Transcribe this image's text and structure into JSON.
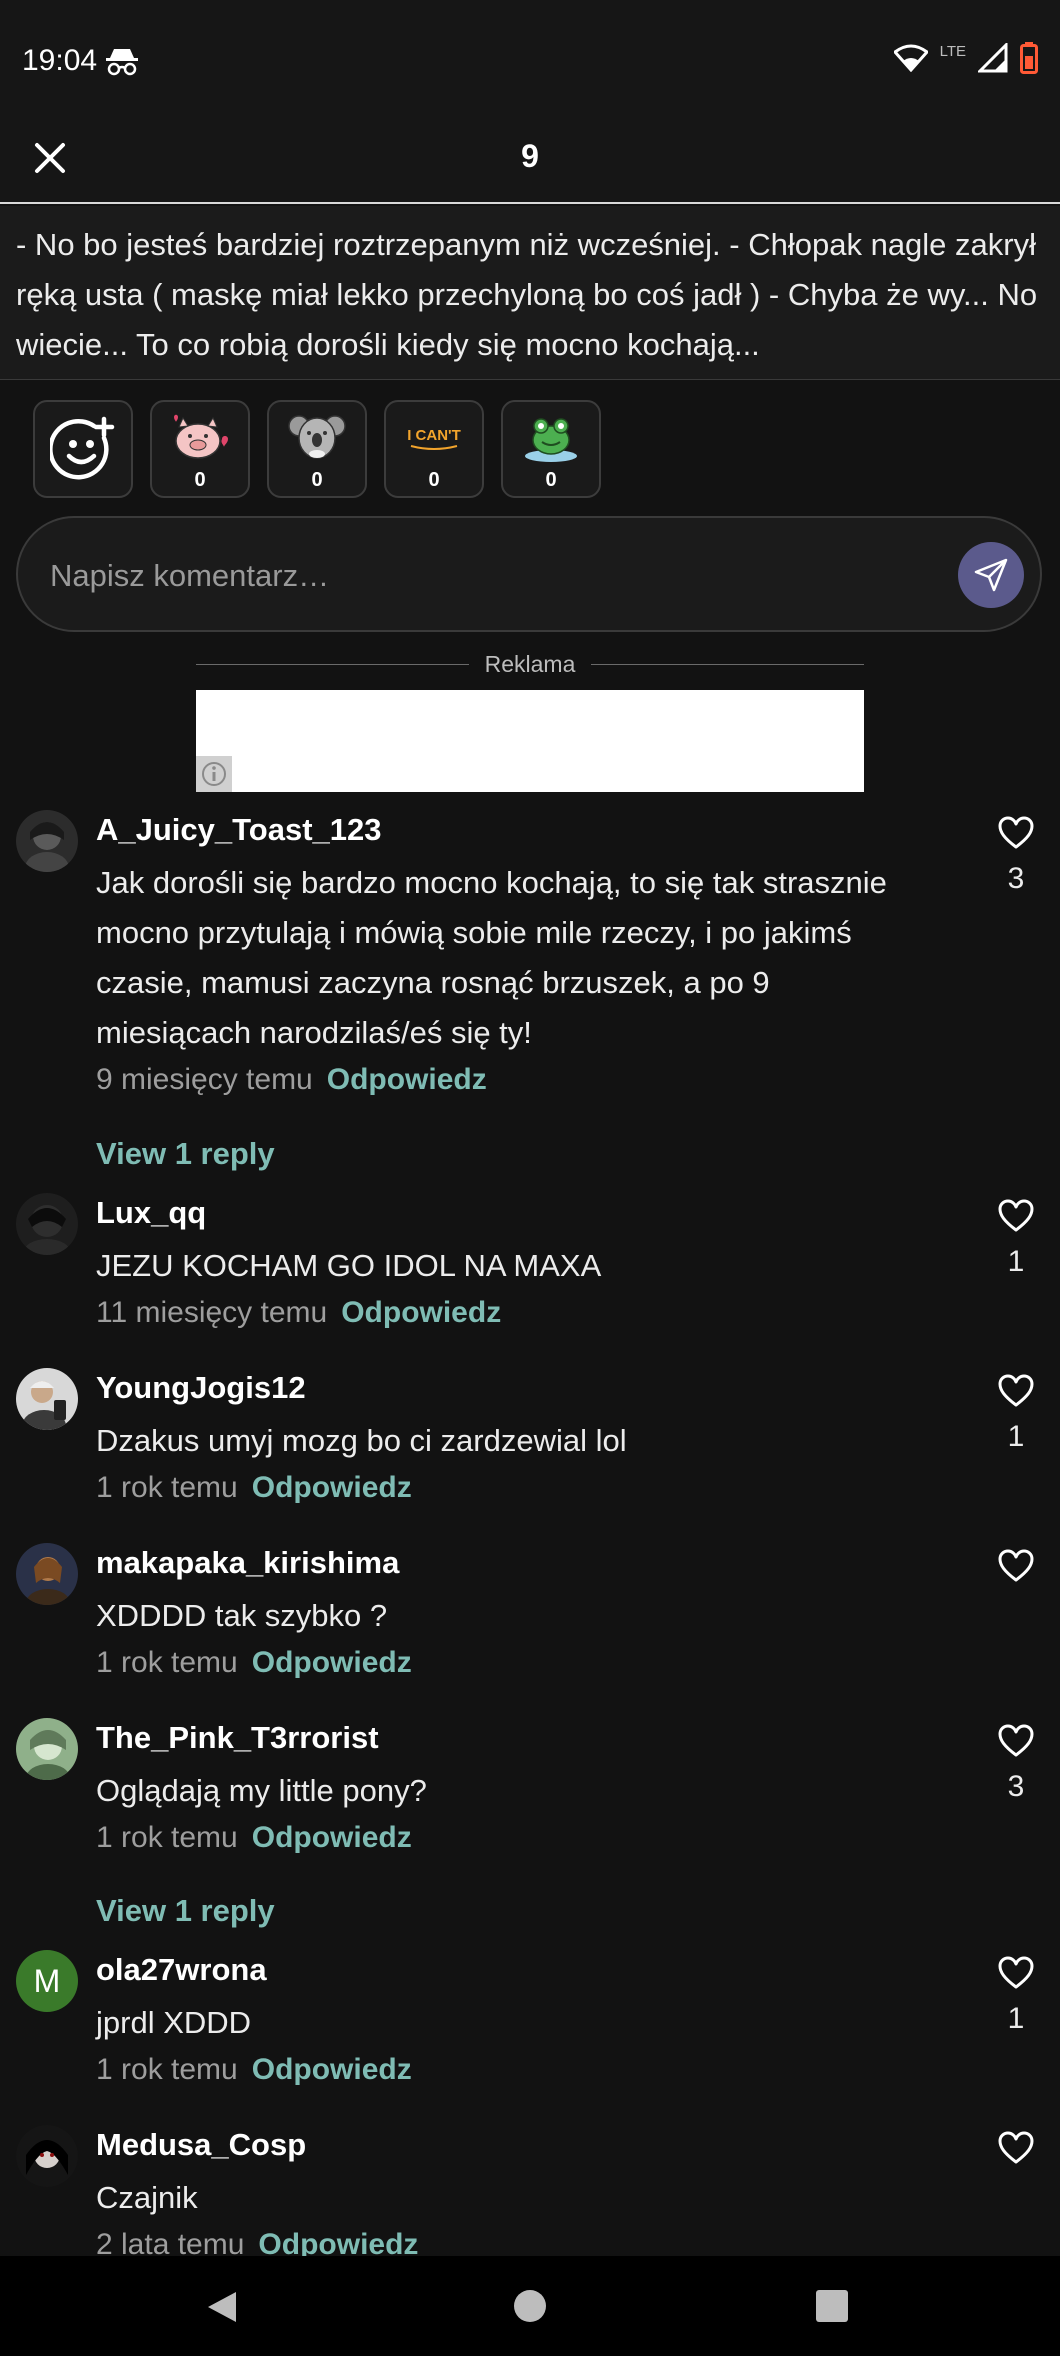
{
  "status_bar": {
    "time": "19:04",
    "network": "LTE"
  },
  "header": {
    "title": "9"
  },
  "story": {
    "text": "- No bo jesteś bardziej roztrzepanym niż wcześniej. - Chłopak nagle zakrył ręką usta ( maskę miał lekko przechyloną bo coś jadł ) - Chyba że wy... No wiecie... To co robią dorośli kiedy się mocno kochają..."
  },
  "reactions": [
    {
      "icon": "pig-sticker-icon",
      "count": "0"
    },
    {
      "icon": "koala-sticker-icon",
      "count": "0"
    },
    {
      "icon": "i-cant-sticker-icon",
      "sticker_text": "I CAN'T",
      "count": "0"
    },
    {
      "icon": "frog-sticker-icon",
      "count": "0"
    }
  ],
  "comment_input": {
    "placeholder": "Napisz komentarz…"
  },
  "ad": {
    "label": "Reklama"
  },
  "comments": [
    {
      "user": "A_Juicy_Toast_123",
      "text": "Jak dorośli się bardzo mocno kochają, to się tak strasznie mocno przytulają i mówią sobie mile rzeczy, i po jakimś czasie, mamusi zaczyna rosnąć brzuszek, a po 9 miesiącach narodzilaś/eś się ty!",
      "time": "9 miesięcy temu",
      "reply": "Odpowiedz",
      "likes": "3",
      "replies_link": "View 1 reply"
    },
    {
      "user": "Lux_qq",
      "text": "JEZU KOCHAM GO IDOL NA MAXA",
      "time": "11 miesięcy temu",
      "reply": "Odpowiedz",
      "likes": "1"
    },
    {
      "user": "YoungJogis12",
      "text": "Dzakus umyj mozg bo ci zardzewial lol",
      "time": "1 rok temu",
      "reply": "Odpowiedz",
      "likes": "1"
    },
    {
      "user": "makapaka_kirishima",
      "text": "XDDDD tak szybko ?",
      "time": "1 rok temu",
      "reply": "Odpowiedz",
      "likes": ""
    },
    {
      "user": "The_Pink_T3rrorist",
      "text": "Oglądają my little pony?",
      "time": "1 rok temu",
      "reply": "Odpowiedz",
      "likes": "3",
      "replies_link": "View 1 reply"
    },
    {
      "user": "ola27wrona",
      "avatar_letter": "M",
      "text": "jprdl XDDD",
      "time": "1 rok temu",
      "reply": "Odpowiedz",
      "likes": "1"
    },
    {
      "user": "Medusa_Cosp",
      "text": "Czajnik",
      "time": "2 lata temu",
      "reply": "Odpowiedz",
      "likes": ""
    }
  ],
  "colors": {
    "background": "#121212",
    "accent": "#7fbcb4",
    "send_button": "#5b5a8c",
    "avatar_m": "#3a7a2a"
  }
}
